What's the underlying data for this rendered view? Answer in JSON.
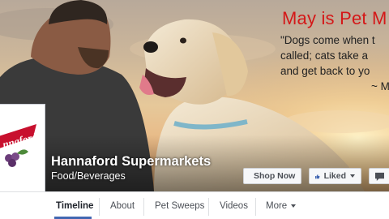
{
  "promo": {
    "title": "May is Pet M",
    "quote_lines": [
      "\"Dogs come when t",
      "called; cats take a",
      "and get back to yo",
      "~ M"
    ]
  },
  "page": {
    "name": "Hannaford Supermarkets",
    "category": "Food/Beverages",
    "logo_text": "nnaford"
  },
  "actions": {
    "shop_now": "Shop Now",
    "liked": "Liked",
    "message_icon": "message-icon"
  },
  "tabs": [
    {
      "label": "Timeline",
      "active": true
    },
    {
      "label": "About",
      "active": false
    },
    {
      "label": "Pet Sweeps",
      "active": false
    },
    {
      "label": "Videos",
      "active": false
    },
    {
      "label": "More",
      "active": false
    }
  ],
  "colors": {
    "promo_red": "#d41818",
    "tab_active_underline": "#4267b2",
    "like_blue": "#4267b2",
    "logo_red": "#c8102e"
  }
}
